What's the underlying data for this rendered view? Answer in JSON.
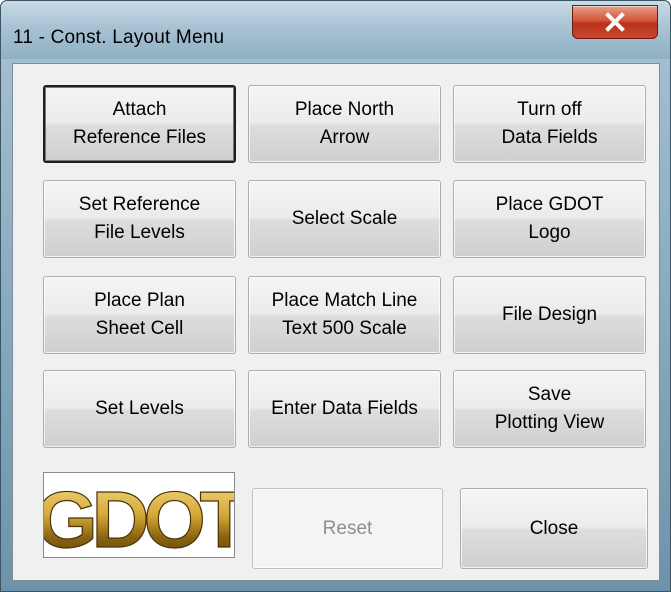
{
  "window": {
    "title": "11 - Const. Layout Menu",
    "close_glyph": "X"
  },
  "buttons": {
    "attach_reference_files": "Attach\nReference Files",
    "place_north_arrow": "Place North\nArrow",
    "turn_off_data_fields": "Turn off\nData Fields",
    "set_reference_file_levels": "Set Reference\nFile Levels",
    "select_scale": "Select Scale",
    "place_gdot_logo": "Place GDOT\nLogo",
    "place_plan_sheet_cell": "Place Plan\nSheet Cell",
    "place_match_line": "Place Match Line\nText 500 Scale",
    "file_design": "File Design",
    "set_levels": "Set Levels",
    "enter_data_fields": "Enter Data Fields",
    "save_plotting_view": "Save\nPlotting View",
    "reset": "Reset",
    "close": "Close"
  },
  "logo": {
    "text": "GDOT",
    "colors": [
      "#f6e08a",
      "#b8860b",
      "#6b4e0a"
    ]
  }
}
